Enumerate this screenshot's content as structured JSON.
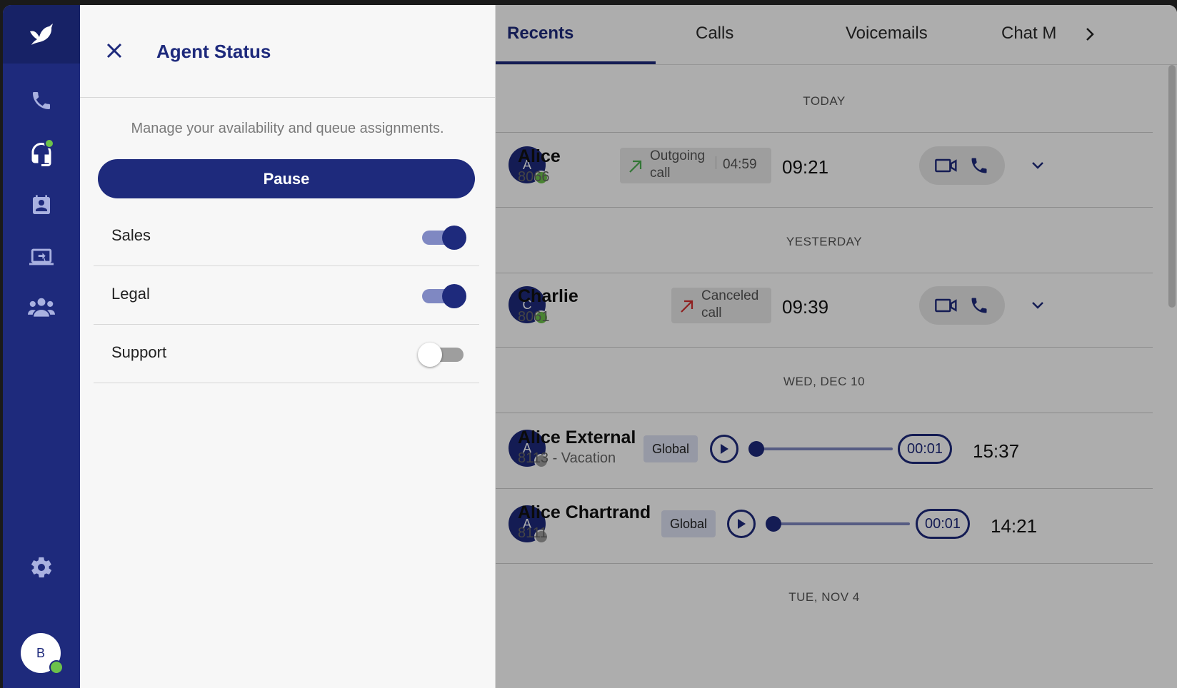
{
  "panel": {
    "title": "Agent Status",
    "description": "Manage your availability and queue assignments.",
    "pause_label": "Pause",
    "queues": [
      {
        "label": "Sales",
        "enabled": true
      },
      {
        "label": "Legal",
        "enabled": true
      },
      {
        "label": "Support",
        "enabled": false
      }
    ]
  },
  "tabs": [
    "Recents",
    "Calls",
    "Voicemails",
    "Chat M"
  ],
  "active_tab": "Recents",
  "sections": [
    "TODAY",
    "YESTERDAY",
    "WED, DEC 10",
    "TUE, NOV 4"
  ],
  "entries": [
    {
      "initial": "A",
      "name": "Alice",
      "ext": "8066",
      "status": "available",
      "call_label_1": "Outgoing",
      "call_label_2": "call",
      "duration": "04:59",
      "time": "09:21"
    },
    {
      "initial": "C",
      "name": "Charlie",
      "ext": "8061",
      "status": "available",
      "call_label_1": "Canceled",
      "call_label_2": "call",
      "time": "09:39"
    },
    {
      "initial": "A",
      "name": "Alice External",
      "ext": "8113 - Vacation",
      "status": "away",
      "tag": "Global",
      "voicemail_duration": "00:01",
      "time": "15:37"
    },
    {
      "initial": "A",
      "name": "Alice Chartrand",
      "ext": "8111",
      "status": "away",
      "tag": "Global",
      "voicemail_duration": "00:01",
      "time": "14:21"
    }
  ],
  "user": {
    "initial": "B"
  },
  "colors": {
    "brand": "#1e2a7c",
    "brand_light": "#7f88c2",
    "presence_ok": "#6cc24a",
    "outgoing": "#4caf50",
    "canceled": "#d32f2f"
  }
}
